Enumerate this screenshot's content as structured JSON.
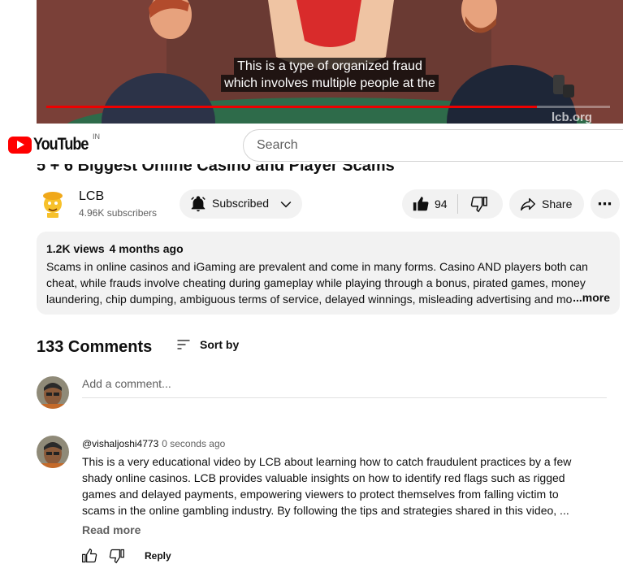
{
  "player": {
    "caption_lines": [
      "This is a type of organized fraud",
      "which involves multiple people at the"
    ],
    "progress": 0.87,
    "watermark": "lcb.org"
  },
  "masthead": {
    "logo_text": "YouTube",
    "region": "IN",
    "search_placeholder": "Search"
  },
  "video": {
    "title": "5 + 6 Biggest Online Casino and Player Scams"
  },
  "channel": {
    "name": "LCB",
    "subscribers": "4.96K subscribers",
    "subscribed_label": "Subscribed",
    "likes": "94",
    "share_label": "Share"
  },
  "description": {
    "views": "1.2K views",
    "age": "4 months ago",
    "lines": [
      "Scams in online casinos and iGaming are prevalent and come in many forms. Casino AND players both can",
      "cheat, while frauds involve cheating during gameplay while playing through a bonus, pirated games, money",
      "laundering, chip dumping, ambiguous terms of service, delayed winnings, misleading advertising and mo"
    ],
    "more_label": "...more"
  },
  "comments": {
    "count_label": "133 Comments",
    "sort_label": "Sort by",
    "add_placeholder": "Add a comment...",
    "items": [
      {
        "author": "@vishaljoshi4773",
        "time": "0 seconds ago",
        "text": "This is a very educational video by LCB about learning how to catch fraudulent practices by a few shady online casinos. LCB provides valuable insights on how to identify red flags such as rigged games and delayed payments, empowering viewers to protect themselves from falling victim to scams in the online gambling industry. By following the tips and strategies shared in this video, ...",
        "read_more": "Read more",
        "reply_label": "Reply"
      }
    ]
  },
  "colors": {
    "youtube_red": "#ff0000",
    "pill_bg": "#f2f2f2",
    "secondary_text": "#606060"
  }
}
